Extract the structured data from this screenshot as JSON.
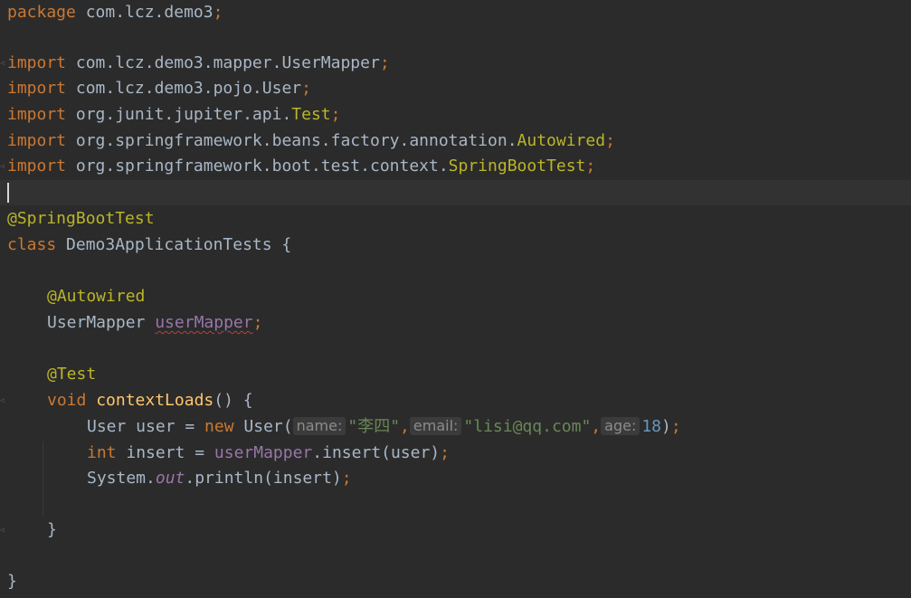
{
  "code": {
    "package_kw": "package",
    "package_name": " com.lcz.demo3",
    "semicolon": ";",
    "import_kw": "import",
    "imports": [
      {
        "pkg": " com.lcz.demo3.mapper.",
        "cls": "UserMapper"
      },
      {
        "pkg": " com.lcz.demo3.pojo.",
        "cls": "User"
      },
      {
        "pkg": " org.junit.jupiter.api.",
        "cls": "Test"
      },
      {
        "pkg": " org.springframework.beans.factory.annotation.",
        "cls": "Autowired"
      },
      {
        "pkg": " org.springframework.boot.test.context.",
        "cls": "SpringBootTest"
      }
    ],
    "class_annotation": "@SpringBootTest",
    "class_kw": "class",
    "class_name": " Demo3ApplicationTests {",
    "field_annotation": "@Autowired",
    "field_type": "UserMapper ",
    "field_name": "userMapper",
    "test_annotation": "@Test",
    "void_kw": "void",
    "method_name": "contextLoads",
    "method_sig_rest": "() {",
    "line1": {
      "prefix": "User user = ",
      "new_kw": "new",
      "ctor": " User(",
      "hint_name": "name:",
      "arg_name": "\"李四\"",
      "comma": ",",
      "hint_email": "email:",
      "arg_email": "\"lisi@qq.com\"",
      "hint_age": "age:",
      "arg_age": "18",
      "end": ")"
    },
    "line2": {
      "int_kw": "int",
      "mid": " insert = ",
      "field": "userMapper",
      "call": ".insert(user)"
    },
    "line3": {
      "system": "System.",
      "out": "out",
      "call": ".println(insert)"
    },
    "close_brace": "}"
  }
}
